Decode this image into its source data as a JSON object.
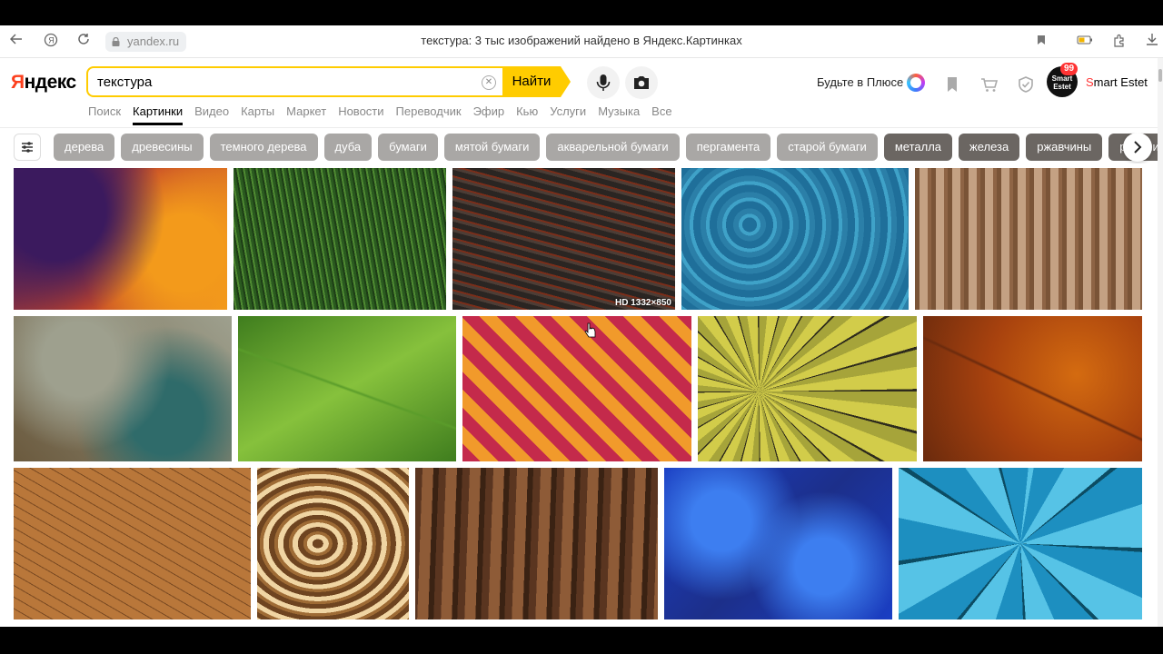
{
  "browser": {
    "url": "yandex.ru",
    "title": "текстура: 3 тыс изображений найдено в Яндекс.Картинках"
  },
  "header": {
    "logo_first": "Я",
    "logo_rest": "ндекс",
    "search_value": "текстура",
    "search_button": "Найти",
    "plus_link": "Будьте в Плюсе",
    "avatar_text": "Smart Estet",
    "avatar_badge": "99",
    "username_first": "S",
    "username_rest": "mart Estet"
  },
  "services": [
    "Поиск",
    "Картинки",
    "Видео",
    "Карты",
    "Маркет",
    "Новости",
    "Переводчик",
    "Эфир",
    "Кью",
    "Услуги",
    "Музыка",
    "Все"
  ],
  "active_service": "Картинки",
  "chips": [
    {
      "label": "дерева",
      "tone": "light"
    },
    {
      "label": "древесины",
      "tone": "light"
    },
    {
      "label": "темного дерева",
      "tone": "light"
    },
    {
      "label": "дуба",
      "tone": "light"
    },
    {
      "label": "бумаги",
      "tone": "light"
    },
    {
      "label": "мятой бумаги",
      "tone": "light"
    },
    {
      "label": "акварельной бумаги",
      "tone": "light"
    },
    {
      "label": "пергамента",
      "tone": "light"
    },
    {
      "label": "старой бумаги",
      "tone": "light"
    },
    {
      "label": "металла",
      "tone": "dark"
    },
    {
      "label": "железа",
      "tone": "dark"
    },
    {
      "label": "ржавчины",
      "tone": "dark"
    },
    {
      "label": "ржавчины",
      "tone": "dark"
    }
  ],
  "images": {
    "hd_label": "HD 1332×850",
    "items": [
      {
        "name": "cosmic-texture",
        "colors": [
          "#3b1a5e",
          "#c2432a",
          "#f39a1b"
        ]
      },
      {
        "name": "grass-texture",
        "colors": [
          "#1d3d16",
          "#4f8a32",
          "#2a5a1f"
        ]
      },
      {
        "name": "bark-texture",
        "colors": [
          "#2a2522",
          "#4c3d36",
          "#7a2e1a"
        ]
      },
      {
        "name": "water-texture",
        "colors": [
          "#1f6f9a",
          "#3fa2c8",
          "#2b7fa8"
        ]
      },
      {
        "name": "wood-texture",
        "colors": [
          "#7a5437",
          "#c4a183",
          "#8e6445"
        ]
      },
      {
        "name": "grunge-texture",
        "colors": [
          "#6b5a3e",
          "#9ea08e",
          "#2f6b6a"
        ]
      },
      {
        "name": "leaf-texture",
        "colors": [
          "#3f7d1e",
          "#86c13c",
          "#5a9c2a"
        ]
      },
      {
        "name": "weave-texture",
        "colors": [
          "#c42a4b",
          "#f19a2b",
          "#5e2a33"
        ]
      },
      {
        "name": "tree-ring-texture",
        "colors": [
          "#a6a43a",
          "#d2cc4a",
          "#2e2b1c"
        ]
      },
      {
        "name": "autumn-leaf-texture",
        "colors": [
          "#6a2a0d",
          "#d46b10",
          "#a8420e"
        ]
      },
      {
        "name": "cracked-earth-texture",
        "colors": [
          "#b9773a",
          "#d89b57",
          "#7a4a22"
        ]
      },
      {
        "name": "swirl-texture",
        "colors": [
          "#6e4420",
          "#f0d5a3",
          "#9e6b35"
        ]
      },
      {
        "name": "tree-bark-texture",
        "colors": [
          "#5a3520",
          "#8e5b37",
          "#3a2213"
        ]
      },
      {
        "name": "blue-paint-texture",
        "colors": [
          "#1a3ec4",
          "#3d7ef0",
          "#1c2f8a"
        ]
      },
      {
        "name": "cracked-blue-texture",
        "colors": [
          "#1d8fc0",
          "#56c3e6",
          "#0c4c63"
        ]
      }
    ]
  }
}
